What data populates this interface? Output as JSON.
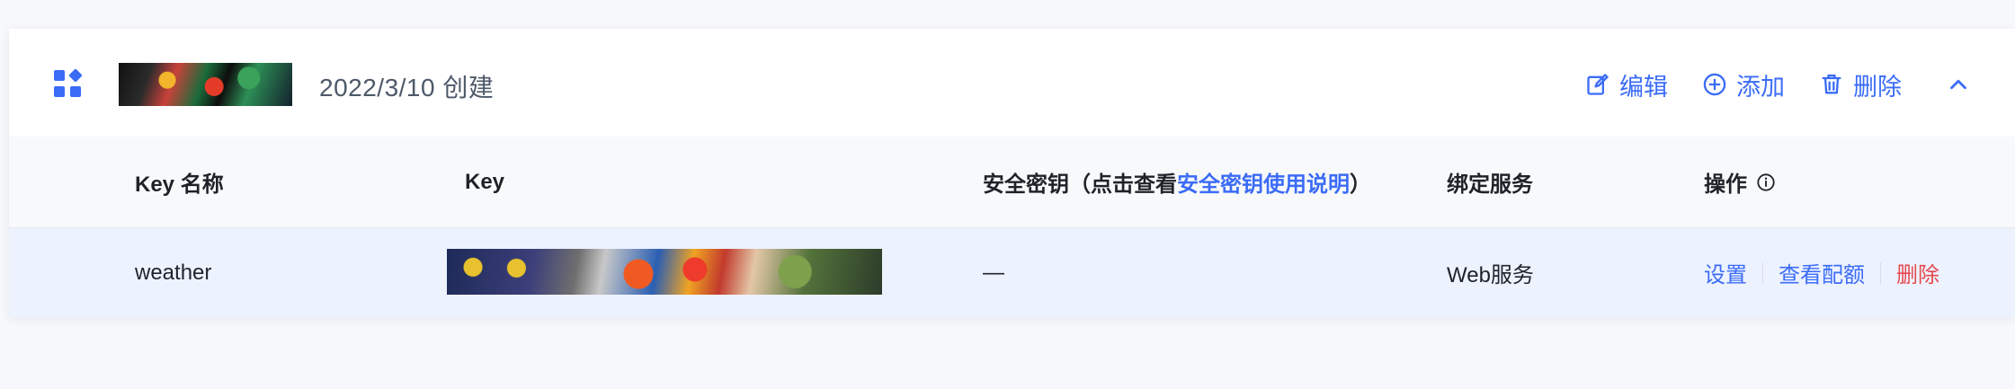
{
  "card": {
    "created": "2022/3/10 创建",
    "actions": {
      "edit": "编辑",
      "add": "添加",
      "delete": "删除"
    }
  },
  "table": {
    "headers": {
      "key_name": "Key 名称",
      "key": "Key",
      "secret_prefix": "安全密钥（点击查看",
      "secret_link": "安全密钥使用说明",
      "secret_suffix": "）",
      "service": "绑定服务",
      "operations": "操作"
    },
    "rows": [
      {
        "name": "weather",
        "secret": "—",
        "service": "Web服务",
        "actions": {
          "settings": "设置",
          "quota": "查看配额",
          "delete": "删除"
        }
      }
    ]
  },
  "icons": {
    "app": "apps-icon",
    "edit": "edit-icon",
    "add": "add-circle-icon",
    "delete": "trash-icon",
    "collapse": "chevron-up-icon",
    "info": "info-icon"
  },
  "colors": {
    "accent": "#3b6cf7",
    "danger": "#e5484d",
    "header_bg": "#f8f9fb",
    "row_highlight": "#edf2ff"
  }
}
